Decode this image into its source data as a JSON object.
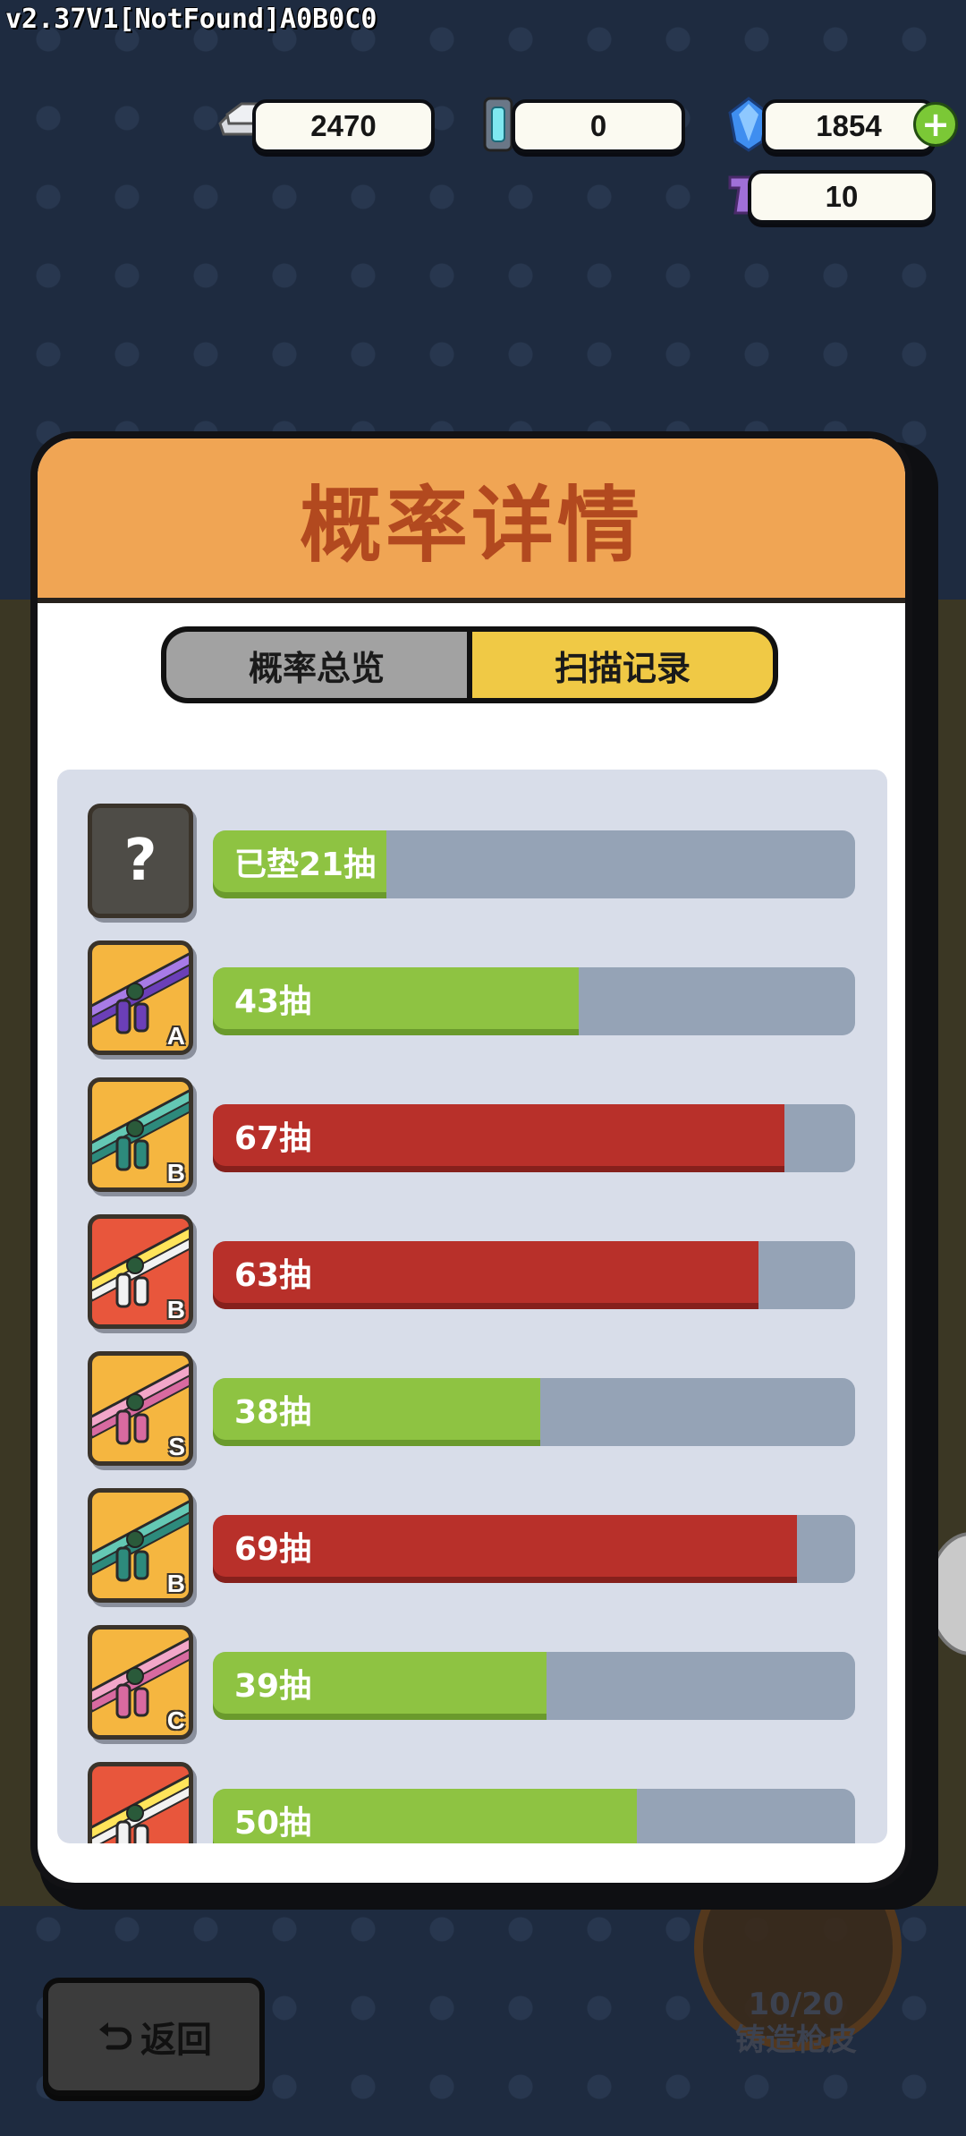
{
  "version": "v2.37V1[NotFound]A0B0C0",
  "currencies": [
    {
      "icon": "silver-ingot-icon",
      "value": "2470"
    },
    {
      "icon": "crystal-capsule-icon",
      "value": "0"
    },
    {
      "icon": "blue-gem-icon",
      "value": "1854"
    },
    {
      "icon": "purple-pistol-icon",
      "value": "10"
    }
  ],
  "plus_label": "+",
  "modal": {
    "title": "概率详情",
    "tabs": [
      {
        "label": "概率总览",
        "active": false
      },
      {
        "label": "扫描记录",
        "active": true
      }
    ]
  },
  "records": [
    {
      "label": "已垫21抽",
      "progress": 0.27,
      "color": "green",
      "grade": "",
      "icon": "question-icon"
    },
    {
      "label": "43抽",
      "progress": 0.57,
      "color": "green",
      "grade": "A",
      "icon": "purple-rifle-icon"
    },
    {
      "label": "67抽",
      "progress": 0.89,
      "color": "red",
      "grade": "B",
      "icon": "teal-rifle-icon"
    },
    {
      "label": "63抽",
      "progress": 0.85,
      "color": "red",
      "grade": "B",
      "icon": "white-rifle-icon"
    },
    {
      "label": "38抽",
      "progress": 0.51,
      "color": "green",
      "grade": "S",
      "icon": "pink-rifle-icon"
    },
    {
      "label": "69抽",
      "progress": 0.91,
      "color": "red",
      "grade": "B",
      "icon": "teal-rifle-icon"
    },
    {
      "label": "39抽",
      "progress": 0.52,
      "color": "green",
      "grade": "C",
      "icon": "pink-rifle-icon"
    },
    {
      "label": "50抽",
      "progress": 0.66,
      "color": "green",
      "grade": "",
      "icon": "white-rifle-icon"
    }
  ],
  "back_button": {
    "label": "返回",
    "icon": "return-arrow-icon"
  },
  "forge": {
    "progress": "10/20",
    "label": "铸造枪皮"
  },
  "colors": {
    "green": "#8ec342",
    "red": "#b8302a",
    "header": "#f0a554",
    "tab_active": "#f0c945"
  }
}
